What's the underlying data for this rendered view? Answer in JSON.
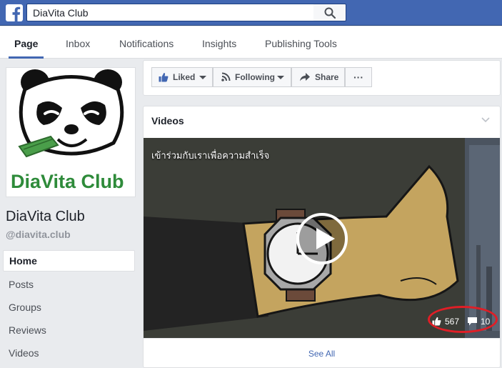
{
  "search": {
    "value": "DiaVita Club"
  },
  "tabs": [
    {
      "label": "Page"
    },
    {
      "label": "Inbox"
    },
    {
      "label": "Notifications"
    },
    {
      "label": "Insights"
    },
    {
      "label": "Publishing Tools"
    }
  ],
  "profile": {
    "logo_text": "DiaVita Club",
    "name": "DiaVita Club",
    "handle": "@diavita.club"
  },
  "nav": [
    {
      "label": "Home"
    },
    {
      "label": "Posts"
    },
    {
      "label": "Groups"
    },
    {
      "label": "Reviews"
    },
    {
      "label": "Videos"
    }
  ],
  "actions": {
    "liked_label": "Liked",
    "following_label": "Following",
    "share_label": "Share",
    "more_label": "···"
  },
  "videos": {
    "title": "Videos",
    "caption": "เข้าร่วมกับเราเพื่อความสำเร็จ",
    "likes": "567",
    "comments": "10",
    "see_all": "See All"
  },
  "colors": {
    "brand_blue": "#4267b2",
    "logo_green": "#2e8b3a",
    "highlight_red": "#e01e26"
  },
  "icons": [
    "facebook-logo-icon",
    "search-icon",
    "thumbs-up-icon",
    "rss-icon",
    "share-arrow-icon",
    "chevron-down-icon",
    "play-icon",
    "comment-icon",
    "panda-logo-icon"
  ]
}
